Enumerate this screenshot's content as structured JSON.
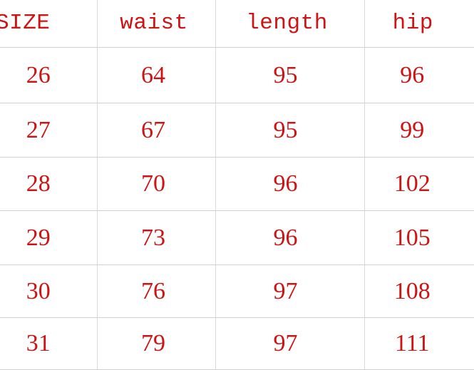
{
  "table": {
    "accent_color": "#cc1414",
    "grid_color": "#d5d5d5",
    "background_color": "#ffffff",
    "headers": [
      {
        "key": "size",
        "label": "SIZE"
      },
      {
        "key": "waist",
        "label": "waist"
      },
      {
        "key": "length",
        "label": "length"
      },
      {
        "key": "hip",
        "label": "hip"
      }
    ],
    "rows": [
      {
        "size": "26",
        "waist": "64",
        "length": "95",
        "hip": "96"
      },
      {
        "size": "27",
        "waist": "67",
        "length": "95",
        "hip": "99"
      },
      {
        "size": "28",
        "waist": "70",
        "length": "96",
        "hip": "102"
      },
      {
        "size": "29",
        "waist": "73",
        "length": "96",
        "hip": "105"
      },
      {
        "size": "30",
        "waist": "76",
        "length": "97",
        "hip": "108"
      },
      {
        "size": "31",
        "waist": "79",
        "length": "97",
        "hip": "111"
      }
    ]
  },
  "chart_data": {
    "type": "table",
    "title": "",
    "columns": [
      "SIZE",
      "waist",
      "length",
      "hip"
    ],
    "rows": [
      [
        "26",
        "64",
        "95",
        "96"
      ],
      [
        "27",
        "67",
        "95",
        "99"
      ],
      [
        "28",
        "70",
        "96",
        "102"
      ],
      [
        "29",
        "73",
        "96",
        "105"
      ],
      [
        "30",
        "76",
        "97",
        "108"
      ],
      [
        "31",
        "79",
        "97",
        "111"
      ]
    ],
    "series": [
      {
        "name": "waist",
        "values": [
          64,
          67,
          70,
          73,
          76,
          79
        ]
      },
      {
        "name": "length",
        "values": [
          95,
          95,
          96,
          96,
          97,
          97
        ]
      },
      {
        "name": "hip",
        "values": [
          96,
          99,
          102,
          105,
          108,
          111
        ]
      }
    ],
    "categories": [
      "26",
      "27",
      "28",
      "29",
      "30",
      "31"
    ],
    "xlabel": "SIZE",
    "ylabel": ""
  }
}
